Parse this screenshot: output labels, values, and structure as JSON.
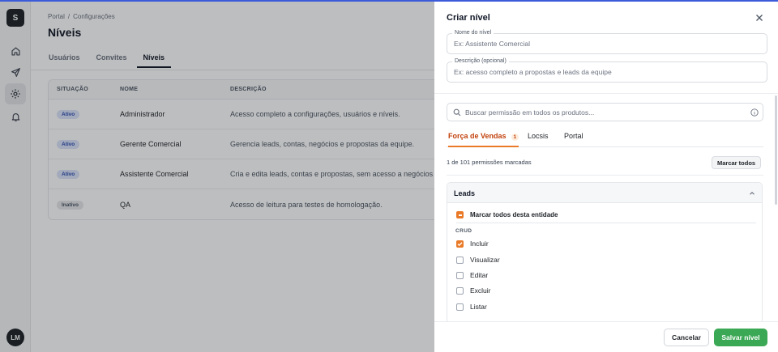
{
  "sidebar": {
    "logo_letter": "S",
    "user_initials": "LM",
    "icons": [
      "home-icon",
      "send-icon",
      "gear-icon",
      "bell-icon"
    ]
  },
  "header": {
    "breadcrumb": [
      "Portal",
      "/",
      "Configurações"
    ],
    "title": "Níveis"
  },
  "tabs": [
    "Usuários",
    "Convites",
    "Níveis"
  ],
  "active_tab": "Níveis",
  "table": {
    "columns": [
      "SITUAÇÃO",
      "NOME",
      "DESCRIÇÃO"
    ],
    "rows": [
      {
        "status": "Ativo",
        "name": "Administrador",
        "description": "Acesso completo a configurações, usuários e níveis."
      },
      {
        "status": "Ativo",
        "name": "Gerente Comercial",
        "description": "Gerencia leads, contas, negócios e propostas da equipe."
      },
      {
        "status": "Ativo",
        "name": "Assistente Comercial",
        "description": "Cria e edita leads, contas e propostas, sem acesso a negócios ou"
      },
      {
        "status": "Inativo",
        "name": "QA",
        "description": "Acesso de leitura para testes de homologação."
      }
    ]
  },
  "drawer": {
    "title": "Criar nível",
    "name_field": {
      "label": "Nome do nível",
      "placeholder": "Ex: Assistente Comercial",
      "value": ""
    },
    "description_field": {
      "label": "Descrição (opcional)",
      "placeholder": "Ex: acesso completo a propostas e leads da equipe",
      "value": ""
    },
    "search_placeholder": "Buscar permissão em todos os produtos...",
    "product_tabs": [
      {
        "label": "Força de Vendas",
        "count": "1"
      },
      {
        "label": "Locsis"
      },
      {
        "label": "Portal"
      }
    ],
    "permissions_count": "1 de 101 permissões marcadas",
    "mark_all_label": "Marcar todos",
    "entity": {
      "name": "Leads",
      "mark_all_entity_label": "Marcar todos desta entidade",
      "group_label": "CRUD",
      "permissions": [
        {
          "label": "Incluir",
          "checked": true
        },
        {
          "label": "Visualizar",
          "checked": false
        },
        {
          "label": "Editar",
          "checked": false
        },
        {
          "label": "Excluir",
          "checked": false
        },
        {
          "label": "Listar",
          "checked": false
        }
      ]
    },
    "cancel_label": "Cancelar",
    "save_label": "Salvar nível"
  },
  "colors": {
    "accent_orange": "#ea7a28",
    "save_green": "#3aa854",
    "top_bar_blue": "#3b5bdb"
  }
}
